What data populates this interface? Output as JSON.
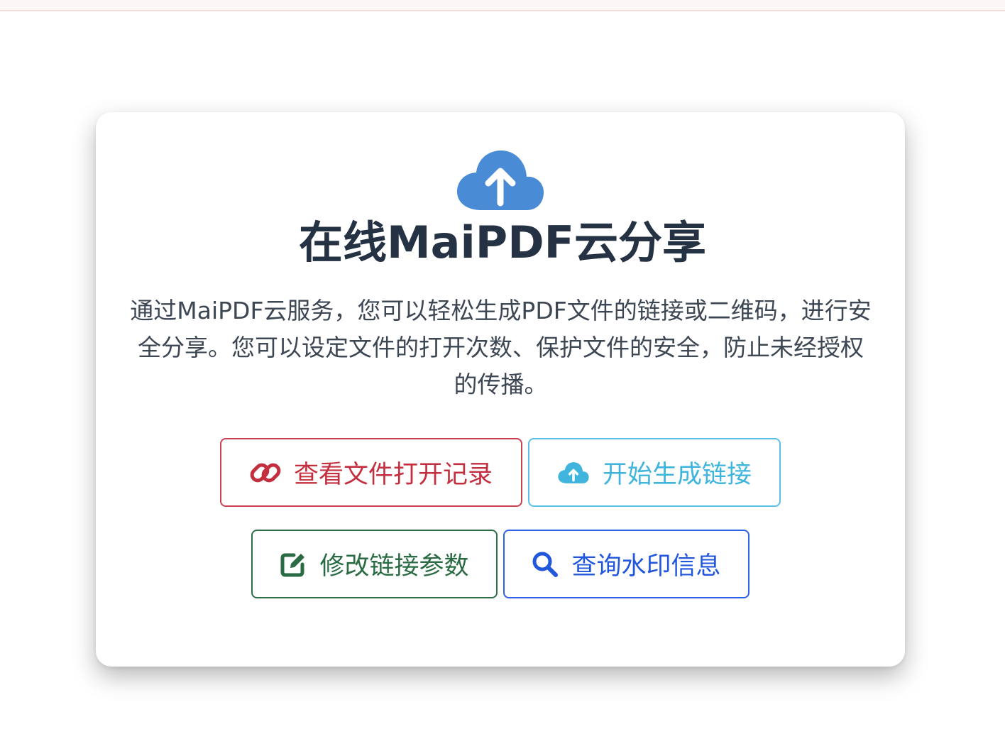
{
  "page": {
    "title": "在线MaiPDF云分享",
    "description": "通过MaiPDF云服务，您可以轻松生成PDF文件的链接或二维码，进行安全分享。您可以设定文件的打开次数、保护文件的安全，防止未经授权的传播。"
  },
  "icons": {
    "header": "cloud-upload-icon",
    "records": "link-icon",
    "generate": "cloud-upload-icon",
    "modify": "edit-icon",
    "query": "search-icon"
  },
  "buttons": {
    "records": "查看文件打开记录",
    "generate": "开始生成链接",
    "modify": "修改链接参数",
    "query": "查询水印信息"
  },
  "colors": {
    "header_icon": "#4a8bd6",
    "title": "#243244",
    "records": "#c42f3f",
    "generate": "#3fb4dc",
    "modify": "#2a6b43",
    "query": "#2157dd"
  }
}
